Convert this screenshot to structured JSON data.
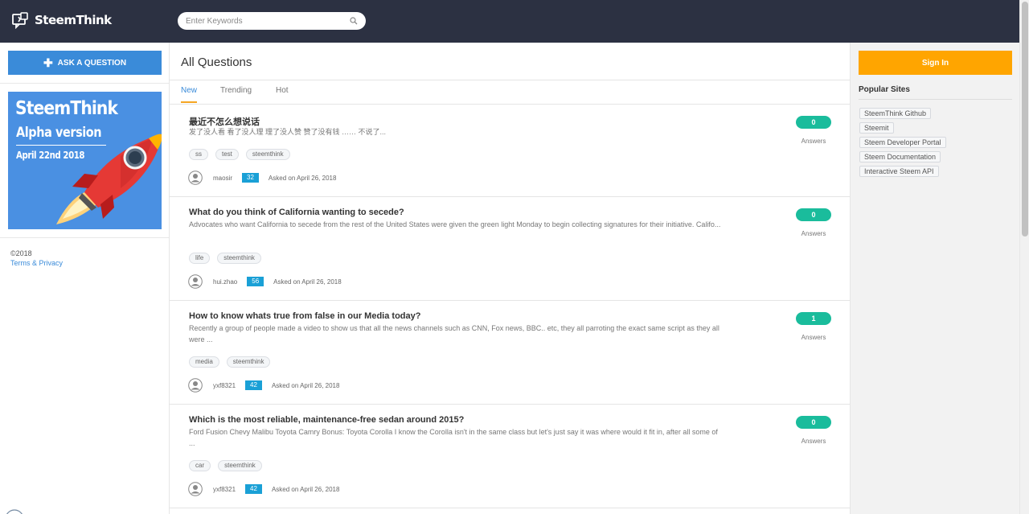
{
  "header": {
    "logo_text": "SteemThink",
    "search_placeholder": "Enter Keywords"
  },
  "left_sidebar": {
    "ask_button": "ASK A QUESTION",
    "banner": {
      "title": "SteemThink",
      "subtitle": "Alpha version",
      "date": "April 22nd 2018"
    },
    "copyright": "©2018",
    "terms_link": "Terms & Privacy"
  },
  "main": {
    "page_title": "All Questions",
    "tabs": [
      {
        "label": "New",
        "active": true
      },
      {
        "label": "Trending",
        "active": false
      },
      {
        "label": "Hot",
        "active": false
      }
    ],
    "questions": [
      {
        "title": "最近不怎么想说话",
        "excerpt": "发了没人看 看了没人理 理了没人赞 赞了没有钱 …… 不说了...",
        "tags": [
          "ss",
          "test",
          "steemthink"
        ],
        "author": "maosir",
        "reputation": "32",
        "asked": "Asked on April 26, 2018",
        "answer_count": "0",
        "answers_label": "Answers"
      },
      {
        "title": "What do you think of California wanting to secede?",
        "excerpt": "Advocates who want California to secede from the rest of the United States were given the green light Monday to begin collecting signatures for their initiative. Califo...",
        "tags": [
          "life",
          "steemthink"
        ],
        "author": "hui.zhao",
        "reputation": "56",
        "asked": "Asked on April 26, 2018",
        "answer_count": "0",
        "answers_label": "Answers"
      },
      {
        "title": "How to know whats true from false in our Media today?",
        "excerpt": "Recently a group of people made a video to show us that all the news channels such as CNN, Fox news, BBC.. etc, they all parroting the exact same script as they all were ...",
        "tags": [
          "media",
          "steemthink"
        ],
        "author": "yxf8321",
        "reputation": "42",
        "asked": "Asked on April 26, 2018",
        "answer_count": "1",
        "answers_label": "Answers"
      },
      {
        "title": "Which is the most reliable, maintenance-free sedan around 2015?",
        "excerpt": "Ford Fusion Chevy Malibu Toyota Camry Bonus: Toyota Corolla I know the Corolla isn't in the same class but let's just say it was where would it fit in, after all some of ...",
        "tags": [
          "car",
          "steemthink"
        ],
        "author": "yxf8321",
        "reputation": "42",
        "asked": "Asked on April 26, 2018",
        "answer_count": "0",
        "answers_label": "Answers"
      }
    ]
  },
  "right_sidebar": {
    "signin_button": "Sign In",
    "popular_title": "Popular Sites",
    "sites": [
      "SteemThink Github",
      "Steemit",
      "Steem Developer Portal",
      "Steem Documentation",
      "Interactive Steem API"
    ]
  },
  "colors": {
    "topbar": "#2c3142",
    "primary": "#3a8bd9",
    "signin": "#ffa500",
    "answers_badge": "#1abc9c",
    "reputation_badge": "#1aa0d6",
    "tab_underline": "#f5a623"
  },
  "icons": [
    "logo-icon",
    "search-icon",
    "plus-icon",
    "rocket-icon",
    "avatar-icon"
  ]
}
